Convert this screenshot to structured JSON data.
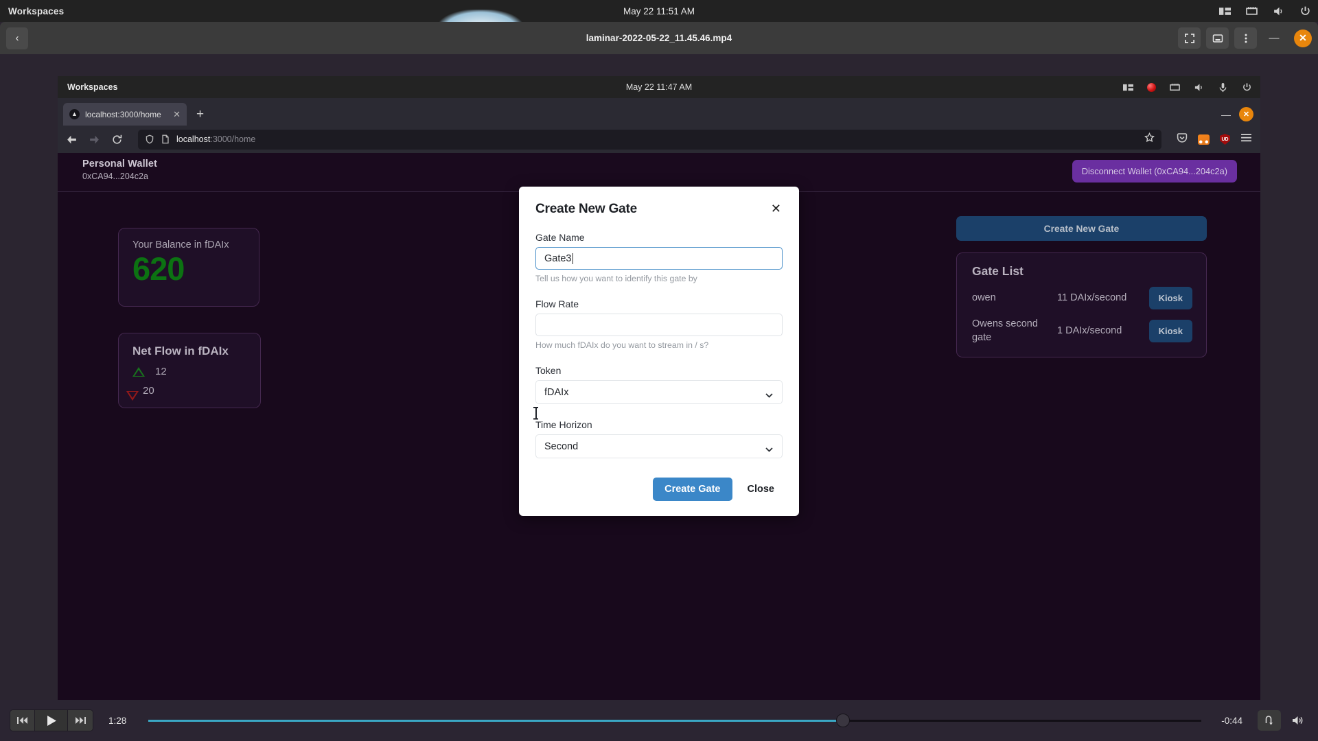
{
  "outer_system_bar": {
    "workspaces_label": "Workspaces",
    "clock": "May 22  11:51 AM",
    "tray_icons": [
      "workspace-switcher-icon",
      "network-icon",
      "volume-icon",
      "power-icon"
    ]
  },
  "video_window": {
    "back_label": "‹",
    "title": "laminar-2022-05-22_11.45.46.mp4",
    "buttons": [
      "fullscreen-icon",
      "picture-in-picture-icon",
      "overflow-menu-icon"
    ],
    "minimize_label": "—",
    "close_label": "✕"
  },
  "inner_system_bar": {
    "workspaces_label": "Workspaces",
    "clock": "May 22  11:47 AM",
    "tray_icons": [
      "workspace-switcher-icon",
      "recording-indicator",
      "network-icon",
      "volume-icon",
      "microphone-icon",
      "power-icon"
    ]
  },
  "browser": {
    "tab": {
      "title": "localhost:3000/home",
      "close_label": "✕",
      "favicon": "triangle-favicon"
    },
    "new_tab_label": "+",
    "minimize_label": "—",
    "close_label": "✕",
    "url_host": "localhost",
    "url_path": ":3000/home",
    "extensions": [
      "pocket-icon",
      "metamask-icon",
      "unstoppable-domains-icon"
    ],
    "ud_badge": "UD"
  },
  "app": {
    "wallet_name": "Personal Wallet",
    "wallet_address": "0xCA94...204c2a",
    "disconnect_label": "Disconnect Wallet (0xCA94...204c2a)",
    "balance_card": {
      "label": "Your Balance in fDAIx",
      "value": "620",
      "value_color": "#0d7a14"
    },
    "netflow_card": {
      "title": "Net Flow in fDAIx",
      "inflow": "12",
      "outflow": "20",
      "inflow_color": "#1a7a1f",
      "outflow_color": "#9d1b1b"
    },
    "create_gate_cta": "Create New Gate",
    "gate_list": {
      "title": "Gate List",
      "rows": [
        {
          "name": "owen",
          "rate": "11 DAIx/second",
          "action": "Kiosk"
        },
        {
          "name": "Owens second gate",
          "rate": "1 DAIx/second",
          "action": "Kiosk"
        }
      ]
    }
  },
  "modal": {
    "title": "Create New Gate",
    "close_label": "✕",
    "gate_name_label": "Gate Name",
    "gate_name_value": "Gate3",
    "gate_name_help": "Tell us how you want to identify this gate by",
    "flow_rate_label": "Flow Rate",
    "flow_rate_value": "",
    "flow_rate_placeholder": "",
    "flow_rate_help": "How much fDAIx do you want to stream in / s?",
    "token_label": "Token",
    "token_value": "fDAIx",
    "time_horizon_label": "Time Horizon",
    "time_horizon_value": "Second",
    "primary_button": "Create Gate",
    "secondary_button": "Close",
    "primary_color": "#3b87c8"
  },
  "player_controls": {
    "skip_back": "skip-back-icon",
    "play": "play-icon",
    "skip_forward": "skip-forward-icon",
    "elapsed": "1:28",
    "remaining": "-0:44",
    "progress_percent": 66,
    "loop": "loop-icon",
    "volume": "volume-icon",
    "accent_color": "#3aa7c4"
  }
}
